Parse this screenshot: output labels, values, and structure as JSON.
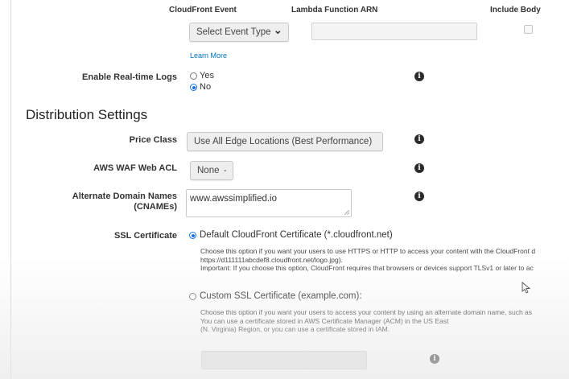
{
  "lambda_table": {
    "col_event": "CloudFront Event",
    "col_arn": "Lambda Function ARN",
    "col_body": "Include Body",
    "event_select": "Select Event Type",
    "arn_value": "",
    "learn_more": "Learn More"
  },
  "realtime_logs": {
    "label": "Enable Real-time Logs",
    "options": [
      "Yes",
      "No"
    ],
    "selected": "No"
  },
  "distribution": {
    "title": "Distribution Settings",
    "price_class": {
      "label": "Price Class",
      "value": "Use All Edge Locations (Best Performance)"
    },
    "waf": {
      "label": "AWS WAF Web ACL",
      "value": "None"
    },
    "cnames": {
      "label_line1": "Alternate Domain Names",
      "label_line2": "(CNAMEs)",
      "value": "www.awssimplified.io"
    },
    "ssl": {
      "label": "SSL Certificate",
      "default_option": "Default CloudFront Certificate (*.cloudfront.net)",
      "default_desc_1": "Choose this option if you want your users to use HTTPS or HTTP to access your content with the CloudFront d",
      "default_desc_2": "https://d111111abcdef8.cloudfront.net/logo.jpg).",
      "default_desc_3": "Important: If you choose this option, CloudFront requires that browsers or devices support TLSv1 or later to ac",
      "custom_option": "Custom SSL Certificate (example.com):",
      "custom_desc_1": "Choose this option if you want your users to access your content by using an alternate domain name, such as",
      "custom_desc_2": "You can use a certificate stored in AWS Certificate Manager (ACM) in the US East",
      "custom_desc_3": "(N. Virginia) Region, or you can use a certificate stored in IAM.",
      "selected": "default"
    }
  },
  "icons": {
    "info": "i",
    "dropdown": "chevron-down-icon"
  },
  "colors": {
    "accent": "#1a73e8",
    "link": "#0073bb"
  }
}
